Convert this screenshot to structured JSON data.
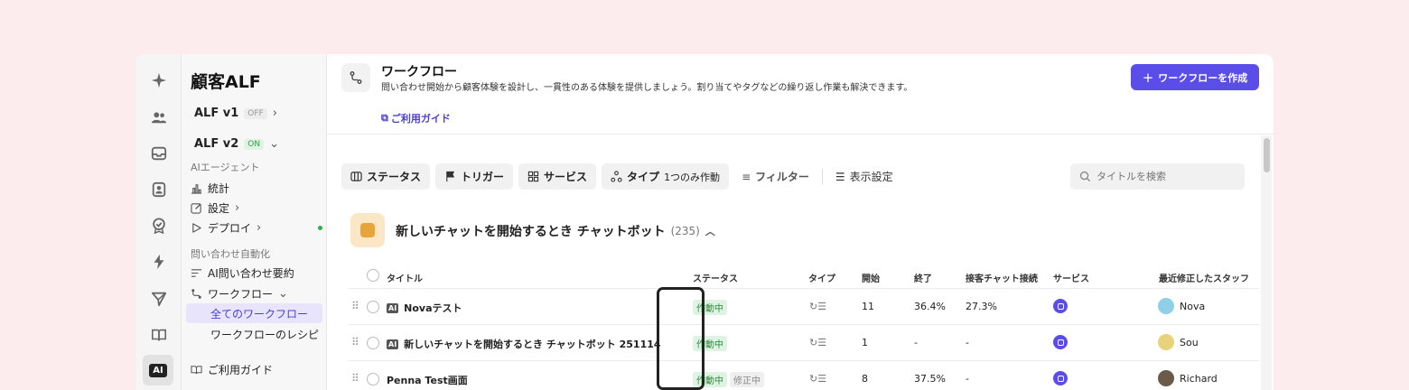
{
  "sidebar": {
    "title": "顧客ALF",
    "v1_label": "ALF v1",
    "v1_badge": "OFF",
    "v2_label": "ALF v2",
    "v2_badge": "ON",
    "section_agent": "AIエージェント",
    "item_stats": "統計",
    "item_settings": "設定",
    "item_deploy": "デプロイ",
    "section_automation": "問い合わせ自動化",
    "item_summary": "AI問い合わせ要約",
    "item_workflow": "ワークフロー",
    "sub_all": "全てのワークフロー",
    "sub_recipes": "ワークフローのレシピ",
    "item_guide": "ご利用ガイド"
  },
  "rail": {
    "ai_label": "AI"
  },
  "header": {
    "title": "ワークフロー",
    "description": "問い合わせ開始から顧客体験を設計し、一貫性のある体験を提供しましょう。割り当てやタグなどの繰り返し作業も解決できます。",
    "guide_link": "ご利用ガイド",
    "create_button": "ワークフローを作成"
  },
  "toolbar": {
    "status": "ステータス",
    "trigger": "トリガー",
    "service": "サービス",
    "type": "タイプ",
    "type_value": "1つのみ作動",
    "filter": "フィルター",
    "display": "表示設定",
    "search_placeholder": "タイトルを検索"
  },
  "group": {
    "title": "新しいチャットを開始するとき チャットボット",
    "count": "(235)"
  },
  "table": {
    "headers": {
      "title": "タイトル",
      "status": "ステータス",
      "type": "タイプ",
      "start": "開始",
      "end": "終了",
      "handoff": "接客チャット接続",
      "service": "サービス",
      "staff": "最近修正したスタッフ"
    },
    "ai_tag": "AI",
    "type_glyph": "↻☰",
    "rows": [
      {
        "title": "Novaテスト",
        "status": "作動中",
        "status2": "",
        "start": "11",
        "end": "36.4%",
        "handoff": "27.3%",
        "staff": "Nova"
      },
      {
        "title": "新しいチャットを開始するとき チャットボット 251114",
        "status": "作動中",
        "status2": "",
        "start": "1",
        "end": "-",
        "handoff": "-",
        "staff": "Sou"
      },
      {
        "title": "Penna Test画面",
        "status": "作動中",
        "status2": "修正中",
        "start": "8",
        "end": "37.5%",
        "handoff": "-",
        "staff": "Richard"
      }
    ]
  },
  "colors": {
    "accent": "#5b4ee8",
    "active_green": "#2e8a3e",
    "background": "#fdecee"
  }
}
